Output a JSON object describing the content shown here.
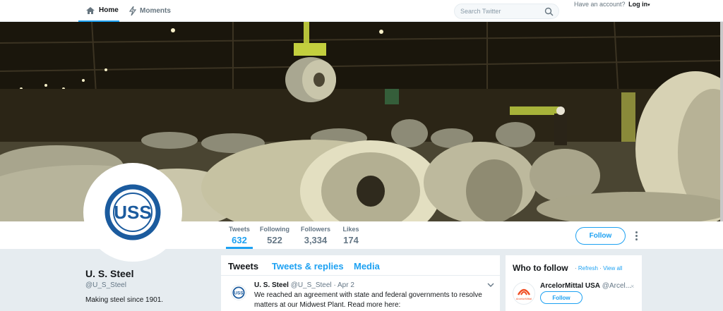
{
  "topnav": {
    "home_label": "Home",
    "moments_label": "Moments",
    "search_placeholder": "Search Twitter",
    "account_prompt": "Have an account?",
    "login_label": "Log in"
  },
  "profile": {
    "name": "U. S. Steel",
    "handle": "@U_S_Steel",
    "bio": "Making steel since 1901.",
    "logo_text": "USS"
  },
  "stats": [
    {
      "label": "Tweets",
      "value": "632"
    },
    {
      "label": "Following",
      "value": "522"
    },
    {
      "label": "Followers",
      "value": "3,334"
    },
    {
      "label": "Likes",
      "value": "174"
    }
  ],
  "follow_label": "Follow",
  "tabs": [
    "Tweets",
    "Tweets & replies",
    "Media"
  ],
  "tweet": {
    "name": "U. S. Steel",
    "handle": "@U_S_Steel",
    "sep": "·",
    "date": "Apr 2",
    "text": "We reached an agreement with state and federal governments to resolve matters at our Midwest Plant. Read more here:"
  },
  "who_to_follow": {
    "title": "Who to follow",
    "sep": "·",
    "refresh": "Refresh",
    "view_all": "View all",
    "account_name": "ArcelorMittal USA",
    "account_handle": "@Arcel...",
    "logo_text": "ArcelorMittal",
    "close": "×",
    "follow_label": "Follow"
  },
  "colors": {
    "accent": "#1da1f2",
    "uss_blue": "#1b5b9e",
    "arcelor_orange": "#f04e23"
  }
}
